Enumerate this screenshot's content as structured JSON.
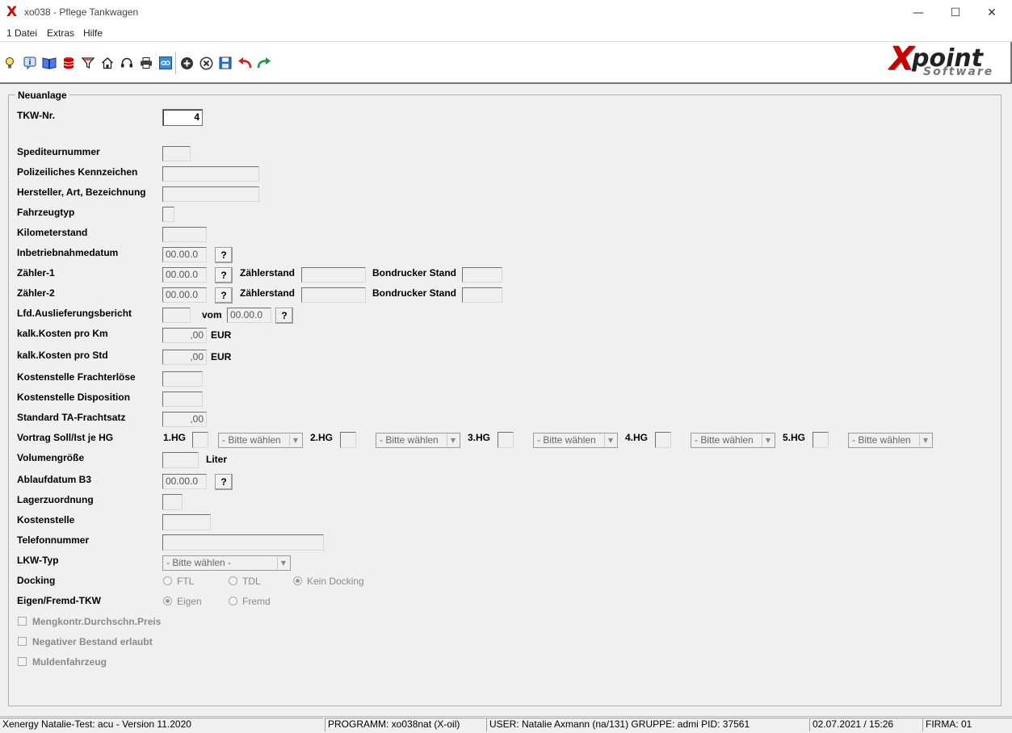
{
  "window": {
    "title": "xo038 - Pflege Tankwagen",
    "app_glyph": "X",
    "minimize_glyph": "—",
    "maximize_glyph": "☐",
    "close_glyph": "✕"
  },
  "menu": [
    "1 Datei",
    "Extras",
    "Hilfe"
  ],
  "toolbar_icons": [
    "lightbulb-icon",
    "info-icon",
    "book-icon",
    "database-icon",
    "filter-icon",
    "home-icon",
    "headset-icon",
    "printer-icon",
    "link-icon",
    "add-icon",
    "cancel-icon",
    "save-icon",
    "undo-icon",
    "redo-icon"
  ],
  "logo": {
    "x": "X",
    "point": "point",
    "software": "Software"
  },
  "form": {
    "group_title": "Neuanlage",
    "tkw_nr": {
      "label": "TKW-Nr.",
      "value": "4"
    },
    "speditor": {
      "label": "Spediteurnummer",
      "value": ""
    },
    "kennzeichen": {
      "label": "Polizeiliches Kennzeichen",
      "value": ""
    },
    "hersteller": {
      "label": "Hersteller, Art, Bezeichnung",
      "value": ""
    },
    "fahrzeugtyp": {
      "label": "Fahrzeugtyp",
      "value": ""
    },
    "kilometerstand": {
      "label": "Kilometerstand",
      "value": ""
    },
    "inbetriebnahme": {
      "label": "Inbetriebnahmedatum",
      "value": "00.00.0"
    },
    "zaehler1": {
      "label": "Zähler-1",
      "value": "00.00.0",
      "stand_label": "Zählerstand",
      "bond_label": "Bondrucker Stand"
    },
    "zaehler2": {
      "label": "Zähler-2",
      "value": "00.00.0",
      "stand_label": "Zählerstand",
      "bond_label": "Bondrucker Stand"
    },
    "lfd_bericht": {
      "label": "Lfd.Auslieferungsbericht",
      "vom_label": "vom",
      "vom_value": "00.00.0"
    },
    "kosten_km": {
      "label": "kalk.Kosten  pro Km",
      "value": ",00",
      "unit": "EUR"
    },
    "kosten_std": {
      "label": "kalk.Kosten  pro Std",
      "value": ",00",
      "unit": "EUR"
    },
    "ks_frachterloese": {
      "label": "Kostenstelle Frachterlöse",
      "value": ""
    },
    "ks_disposition": {
      "label": "Kostenstelle Disposition",
      "value": ""
    },
    "ta_frachtsatz": {
      "label": "Standard TA-Frachtsatz",
      "value": ",00"
    },
    "vortrag": {
      "label": "Vortrag Soll/Ist je HG",
      "hg": [
        "1.HG",
        "2.HG",
        "3.HG",
        "4.HG",
        "5.HG"
      ],
      "select_placeholder": "- Bitte wählen"
    },
    "volumen": {
      "label": "Volumengröße",
      "unit": "Liter"
    },
    "ablaufdatum": {
      "label": "Ablaufdatum B3",
      "value": "00.00.0"
    },
    "lagerzuordnung": {
      "label": "Lagerzuordnung"
    },
    "kostenstelle": {
      "label": "Kostenstelle"
    },
    "telefon": {
      "label": "Telefonnummer"
    },
    "lkw_typ": {
      "label": "LKW-Typ",
      "value": "- Bitte wählen -"
    },
    "docking": {
      "label": "Docking",
      "options": [
        "FTL",
        "TDL",
        "Kein Docking"
      ],
      "selected": "Kein Docking"
    },
    "eigen_fremd": {
      "label": "Eigen/Fremd-TKW",
      "options": [
        "Eigen",
        "Fremd"
      ],
      "selected": "Eigen"
    },
    "checkboxes": [
      "Mengkontr.Durchschn.Preis",
      "Negativer Bestand erlaubt",
      "Muldenfahrzeug"
    ],
    "question_btn": "?",
    "dropdown_arrow": "▼"
  },
  "statusbar": {
    "version": "Xenergy Natalie-Test: acu - Version 11.2020",
    "programm": "PROGRAMM: xo038nat (X-oil)",
    "user": "USER: Natalie Axmann (na/131)  GRUPPE: admi  PID: 37561",
    "datetime": "02.07.2021 / 15:26",
    "firma": "FIRMA: 01"
  }
}
